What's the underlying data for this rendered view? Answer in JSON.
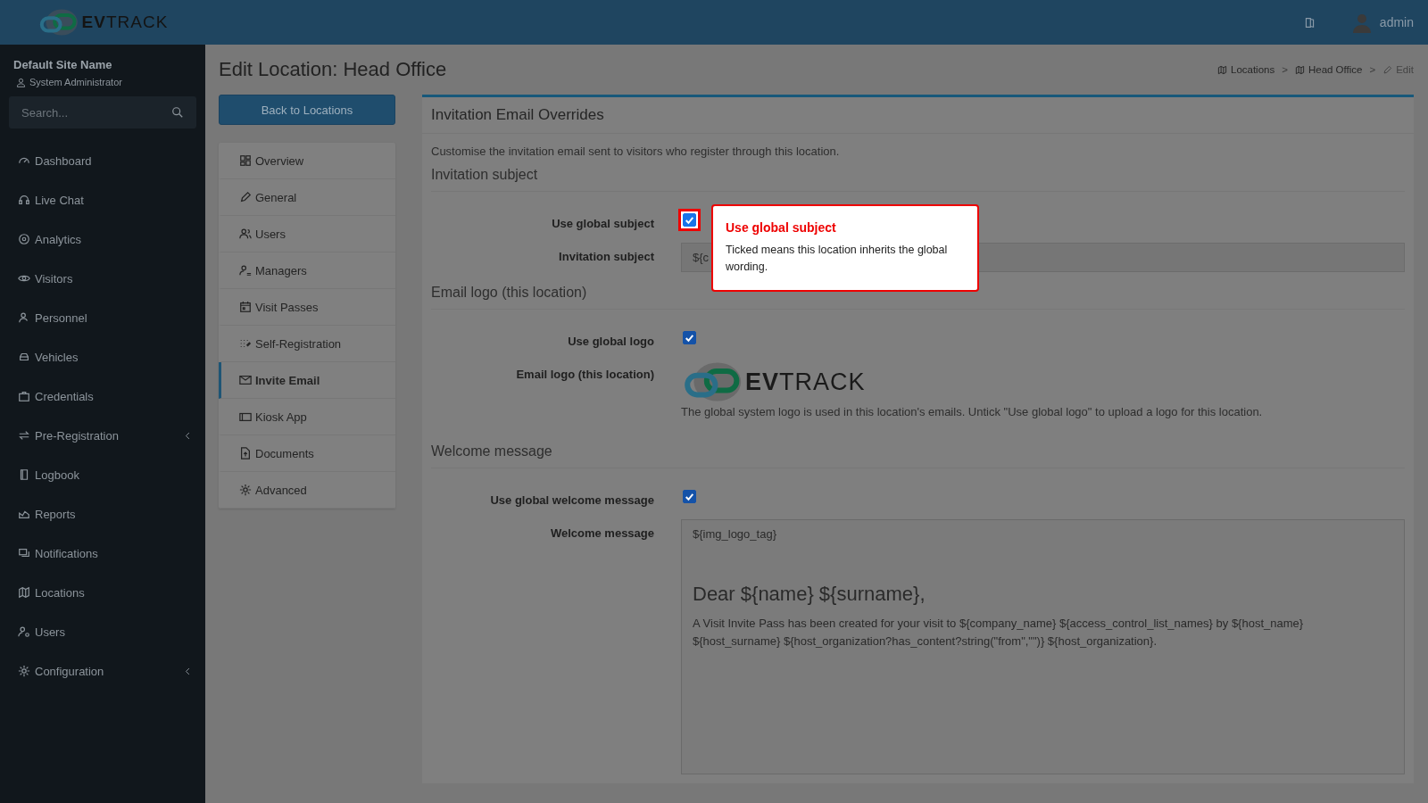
{
  "header": {
    "logo": {
      "prefix": "EV",
      "suffix": "TRACK"
    },
    "user": "admin"
  },
  "sidebar": {
    "site_name": "Default Site Name",
    "role": "System Administrator",
    "search": {
      "placeholder": "Search..."
    },
    "items": [
      {
        "label": "Dashboard",
        "expandable": false
      },
      {
        "label": "Live Chat",
        "expandable": false
      },
      {
        "label": "Analytics",
        "expandable": false
      },
      {
        "label": "Visitors",
        "expandable": false
      },
      {
        "label": "Personnel",
        "expandable": false
      },
      {
        "label": "Vehicles",
        "expandable": false
      },
      {
        "label": "Credentials",
        "expandable": false
      },
      {
        "label": "Pre-Registration",
        "expandable": true
      },
      {
        "label": "Logbook",
        "expandable": false
      },
      {
        "label": "Reports",
        "expandable": false
      },
      {
        "label": "Notifications",
        "expandable": false
      },
      {
        "label": "Locations",
        "expandable": false
      },
      {
        "label": "Users",
        "expandable": false
      },
      {
        "label": "Configuration",
        "expandable": true
      }
    ]
  },
  "page": {
    "title": "Edit Location: Head Office",
    "breadcrumbs": [
      {
        "label": "Locations"
      },
      {
        "separator": ">",
        "label": "Head Office"
      },
      {
        "separator": ">",
        "label": "Edit"
      }
    ],
    "back_button": "Back to Locations",
    "subnav": [
      {
        "label": "Overview",
        "selected": false
      },
      {
        "label": "General",
        "selected": false
      },
      {
        "label": "Users",
        "selected": false
      },
      {
        "label": "Managers",
        "selected": false
      },
      {
        "label": "Visit Passes",
        "selected": false
      },
      {
        "label": "Self-Registration",
        "selected": false
      },
      {
        "label": "Invite Email",
        "selected": true
      },
      {
        "label": "Kiosk App",
        "selected": false
      },
      {
        "label": "Documents",
        "selected": false
      },
      {
        "label": "Advanced",
        "selected": false
      }
    ]
  },
  "card": {
    "title": "Invitation Email Overrides",
    "intro": "Customise the invitation email sent to visitors who register through this location.",
    "sections": [
      {
        "heading": "Invitation subject",
        "rows": [
          {
            "kind": "checkbox",
            "label": "Use global subject",
            "checked": true,
            "highlighted": true
          },
          {
            "kind": "input",
            "label": "Invitation subject",
            "value": "${c"
          }
        ]
      },
      {
        "heading": "Email logo (this location)",
        "rows": [
          {
            "kind": "checkbox",
            "label": "Use global logo",
            "checked": true,
            "highlighted": false
          },
          {
            "kind": "logo",
            "label": "Email logo (this location)",
            "logo": {
              "prefix": "EV",
              "suffix": "TRACK"
            },
            "help": "The global system logo is used in this location's emails. Untick \"Use global logo\" to upload a logo for this location."
          }
        ]
      },
      {
        "heading": "Welcome message",
        "rows": [
          {
            "kind": "checkbox",
            "label": "Use global welcome message",
            "checked": true,
            "highlighted": false
          },
          {
            "kind": "editor",
            "label": "Welcome message",
            "lines": [
              {
                "kind": "text",
                "text": "${img_logo_tag}"
              },
              {
                "kind": "heading",
                "text": "Dear ${name} ${surname},"
              },
              {
                "kind": "text",
                "text": "A Visit Invite Pass has been created for your visit to ${company_name} ${access_control_list_names} by ${host_name} ${host_surname} ${host_organization?has_content?string(\"from\",\"\")} ${host_organization}."
              }
            ]
          }
        ]
      }
    ]
  },
  "tooltip": {
    "title": "Use global subject",
    "body": "Ticked means this location inherits the global wording."
  }
}
